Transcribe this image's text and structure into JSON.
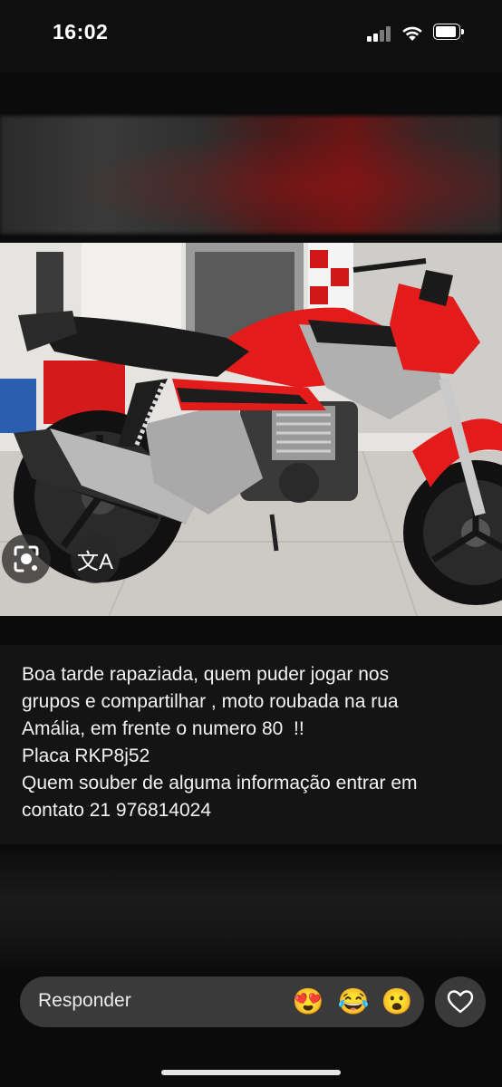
{
  "status_bar": {
    "time": "16:02"
  },
  "post": {
    "caption_lines": [
      "Boa tarde rapaziada, quem puder jogar nos",
      "grupos e compartilhar , moto roubada na rua",
      "Amália, em frente o numero 80  !!",
      "Placa RKP8j52",
      "Quem souber de alguma informação entrar em",
      "contato 21 976814024"
    ]
  },
  "photo_overlay": {
    "lens_icon": "lens-search-icon",
    "translate_icon": "translate-icon",
    "translate_glyph": "文A"
  },
  "reply": {
    "placeholder": "Responder",
    "reactions": [
      {
        "name": "heart-eyes-emoji",
        "glyph": "😍"
      },
      {
        "name": "tears-of-joy-emoji",
        "glyph": "😂"
      },
      {
        "name": "surprised-emoji",
        "glyph": "😮"
      }
    ],
    "like_icon": "heart-icon"
  },
  "colors": {
    "background": "#0b0b0b",
    "caption_bg": "#141414",
    "reply_bg": "#3a3a3a",
    "motorcycle_red": "#e31b1b"
  }
}
